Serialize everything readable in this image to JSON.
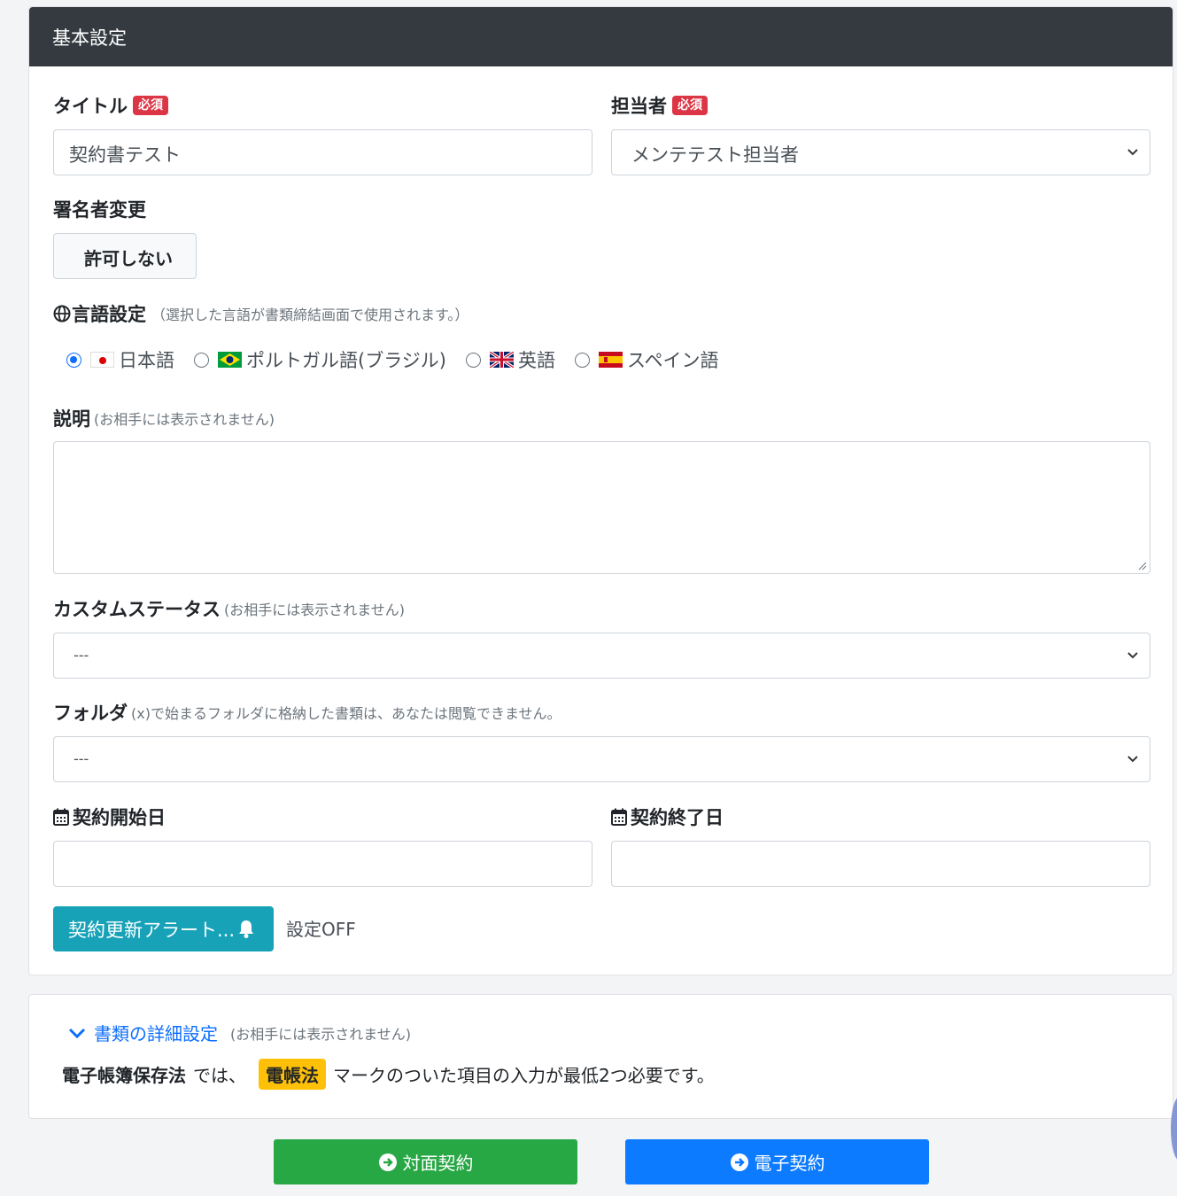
{
  "header": {
    "title": "基本設定"
  },
  "form": {
    "title_label": "タイトル",
    "required_badge": "必須",
    "title_value": "契約書テスト",
    "owner_label": "担当者",
    "owner_value": "メンテテスト担当者",
    "signer_change_label": "署名者変更",
    "signer_change_value": "許可しない",
    "language_label": "言語設定",
    "language_note": "（選択した言語が書類締結画面で使用されます。）",
    "languages": [
      {
        "label": "日本語",
        "flag": "jp-flag-icon",
        "selected": true
      },
      {
        "label": "ポルトガル語(ブラジル)",
        "flag": "br-flag-icon",
        "selected": false
      },
      {
        "label": "英語",
        "flag": "uk-flag-icon",
        "selected": false
      },
      {
        "label": "スペイン語",
        "flag": "es-flag-icon",
        "selected": false
      }
    ],
    "description_label": "説明",
    "hidden_note": "(お相手には表示されません)",
    "custom_status_label": "カスタムステータス",
    "custom_status_value": "---",
    "folder_label": "フォルダ",
    "folder_note": "(x)で始まるフォルダに格納した書類は、あなたは閲覧できません。",
    "folder_value": "---",
    "start_date_label": "契約開始日",
    "end_date_label": "契約終了日",
    "start_date_value": "",
    "end_date_value": "",
    "alert_button": "契約更新アラート...",
    "alert_status": "設定OFF"
  },
  "detail": {
    "toggle_label": "書類の詳細設定",
    "toggle_note": "(お相手には表示されません)",
    "law_name": "電子帳簿保存法",
    "law_text_1": "では、",
    "law_badge": "電帳法",
    "law_text_2": "マークのついた項目の入力が最低2つ必要です。"
  },
  "actions": {
    "in_person": "対面契約",
    "electronic": "電子契約"
  },
  "colors": {
    "header_bg": "#343a40",
    "required": "#dc3545",
    "info": "#17a2b8",
    "success": "#28a745",
    "primary": "#0d7bff",
    "warning": "#ffc107"
  }
}
